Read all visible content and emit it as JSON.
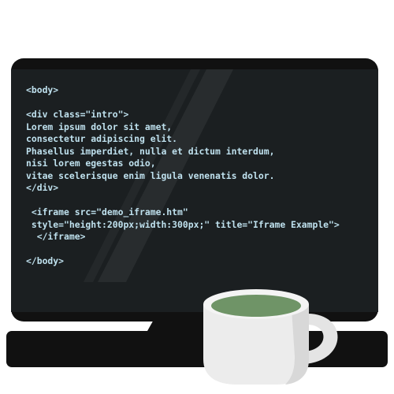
{
  "code": {
    "lines": [
      "<body>",
      "",
      "<div class=\"intro\">",
      "Lorem ipsum dolor sit amet,",
      "consectetur adipiscing elit.",
      "Phasellus imperdiet, nulla et dictum interdum,",
      "nisi lorem egestas odio,",
      "vitae scelerisque enim ligula venenatis dolor.",
      "</div>",
      "",
      " <iframe src=\"demo_iframe.htm\"",
      " style=\"height:200px;width:300px;\" title=\"Iframe Example\">",
      "  </iframe>",
      "",
      "</body>"
    ]
  },
  "colors": {
    "screen_bezel": "#111111",
    "screen_face": "#1b1f21",
    "code_text": "#bfe1ee",
    "mug_body": "#ececec",
    "mug_shadow": "#d4d4d4",
    "tea": "#6f9467",
    "page_background": "#ffffff"
  },
  "icons": {
    "monitor": "monitor-icon",
    "mug": "coffee-mug-icon"
  }
}
